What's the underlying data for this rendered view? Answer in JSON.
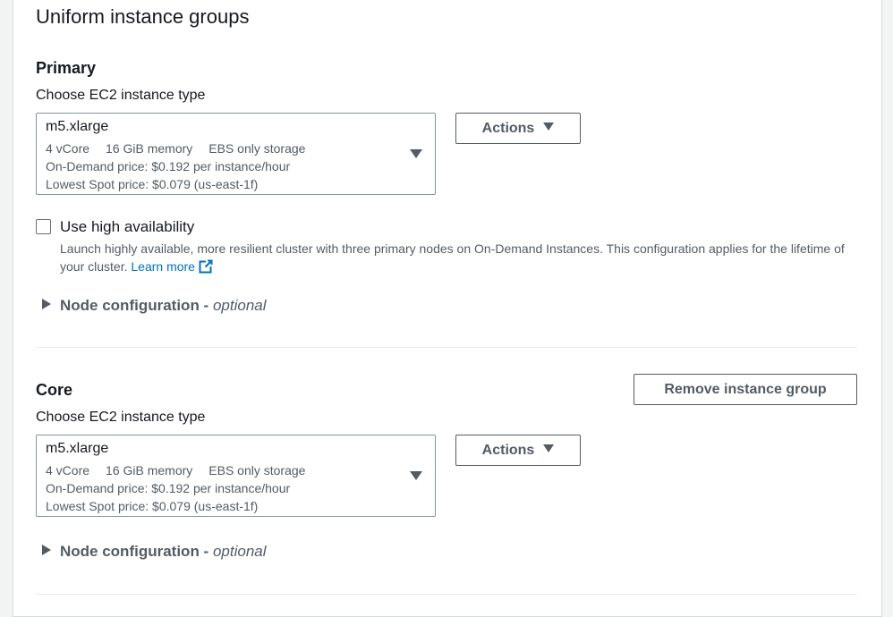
{
  "page": {
    "title": "Uniform instance groups"
  },
  "primary": {
    "title": "Primary",
    "field_label": "Choose EC2 instance type",
    "select": {
      "value": "m5.xlarge",
      "tags": [
        "4 vCore",
        "16 GiB memory",
        "EBS only storage"
      ],
      "on_demand": "On-Demand price: $0.192 per instance/hour",
      "spot": "Lowest Spot price: $0.079 (us-east-1f)"
    },
    "actions_label": "Actions",
    "high_availability": {
      "label": "Use high availability",
      "checked": false,
      "description": "Launch highly available, more resilient cluster with three primary nodes on On-Demand Instances. This configuration applies for the lifetime of your cluster.",
      "learn_more": "Learn more"
    },
    "node_config": {
      "label": "Node configuration -",
      "optional": "optional"
    }
  },
  "core": {
    "title": "Core",
    "remove_label": "Remove instance group",
    "field_label": "Choose EC2 instance type",
    "select": {
      "value": "m5.xlarge",
      "tags": [
        "4 vCore",
        "16 GiB memory",
        "EBS only storage"
      ],
      "on_demand": "On-Demand price: $0.192 per instance/hour",
      "spot": "Lowest Spot price: $0.079 (us-east-1f)"
    },
    "actions_label": "Actions",
    "node_config": {
      "label": "Node configuration -",
      "optional": "optional"
    }
  },
  "icons": {
    "caret": "caret-down-icon",
    "expand": "caret-right-icon",
    "external": "external-link-icon"
  },
  "colors": {
    "link": "#0073bb",
    "border": "#879596",
    "text_secondary": "#545b64"
  }
}
